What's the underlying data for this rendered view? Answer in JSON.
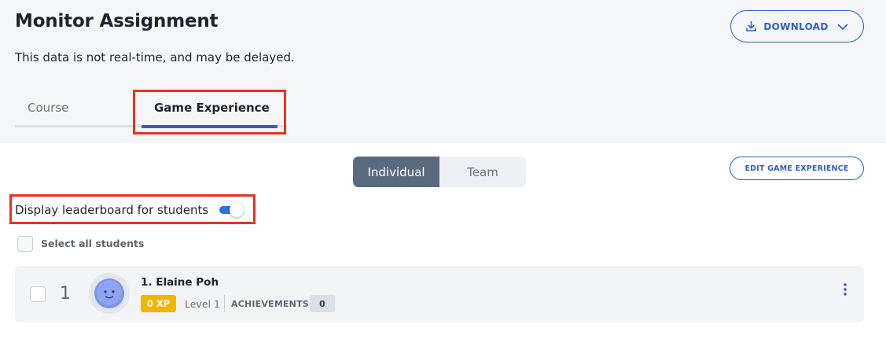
{
  "page": {
    "title": "Monitor Assignment",
    "subtitle": "This data is not real-time, and may be delayed."
  },
  "download": {
    "label": "DOWNLOAD",
    "icon": "download-icon",
    "chevron_icon": "chevron-down-icon"
  },
  "tabs": [
    {
      "label": "Course",
      "active": false
    },
    {
      "label": "Game Experience",
      "active": true
    }
  ],
  "view_toggle": {
    "options": [
      {
        "label": "Individual",
        "active": true
      },
      {
        "label": "Team",
        "active": false
      }
    ]
  },
  "edit_button": {
    "label": "EDIT GAME EXPERIENCE"
  },
  "leaderboard": {
    "label": "Display leaderboard for students",
    "enabled": true
  },
  "select_all": {
    "label": "Select all students",
    "checked": false
  },
  "students": [
    {
      "rank": "1",
      "name": "1. Elaine Poh",
      "xp": "0 XP",
      "level": "Level 1",
      "achievements_label": "ACHIEVEMENTS",
      "achievements_count": "0",
      "checked": false
    }
  ],
  "colors": {
    "accent": "#2f5fc4",
    "highlight": "#e8321c",
    "xp_badge": "#f4b400",
    "segment_active": "#5a6a7e",
    "toggle_on": "#2f6fe0"
  }
}
